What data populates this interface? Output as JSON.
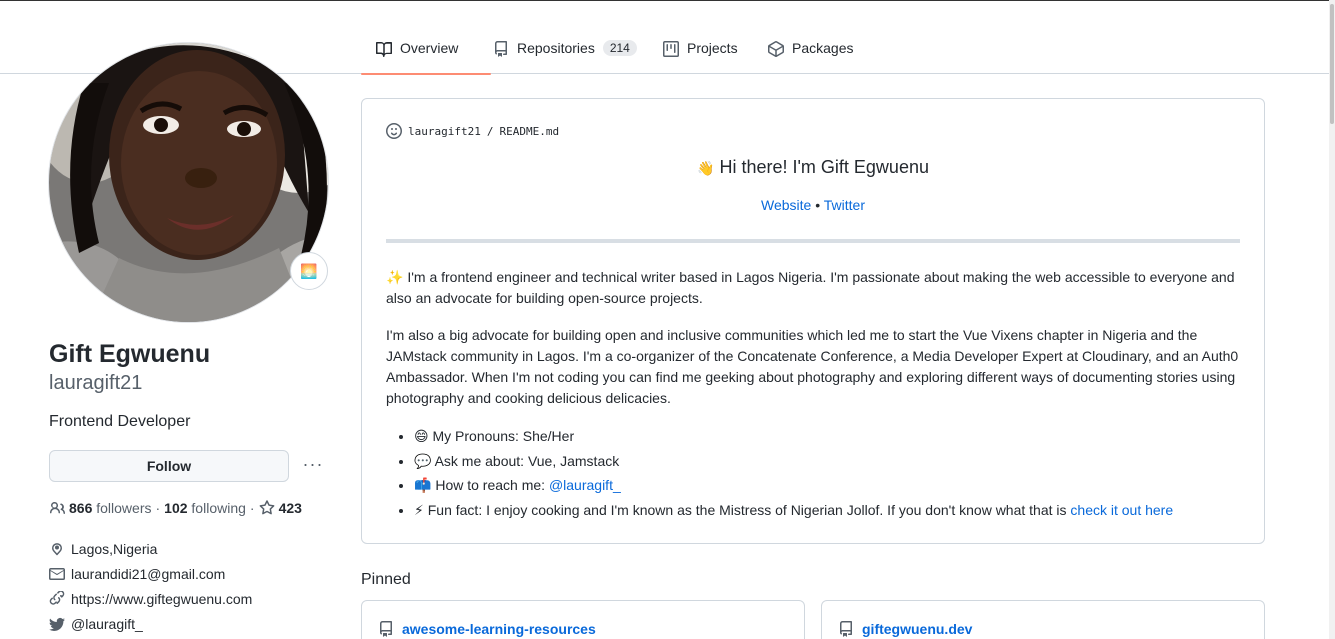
{
  "tabs": [
    {
      "label": "Overview",
      "icon": "book-icon"
    },
    {
      "label": "Repositories",
      "icon": "repo-icon",
      "count": "214"
    },
    {
      "label": "Projects",
      "icon": "project-icon"
    },
    {
      "label": "Packages",
      "icon": "package-icon"
    }
  ],
  "profile": {
    "name": "Gift Egwuenu",
    "login": "lauragift21",
    "bio": "Frontend Developer",
    "follow_label": "Follow",
    "more_label": "···",
    "status_emoji": "🌅",
    "followers_count": "866",
    "followers_label": "followers",
    "following_count": "102",
    "following_label": "following",
    "stars_count": "423",
    "location": "Lagos,Nigeria",
    "email": "laurandidi21@gmail.com",
    "website": "https://www.giftegwuenu.com",
    "twitter": "@lauragift_"
  },
  "readme": {
    "owner": "lauragift21",
    "separator": "/",
    "file": "README.md",
    "title_emoji": "👋",
    "title": "Hi there! I'm Gift Egwuenu",
    "link_website": "Website",
    "link_sep": "•",
    "link_twitter": "Twitter",
    "para1_emoji": "✨",
    "para1": "I'm a frontend engineer and technical writer based in Lagos Nigeria. I'm passionate about making the web accessible to everyone and also an advocate for building open-source projects.",
    "para2": "I'm also a big advocate for building open and inclusive communities which led me to start the Vue Vixens chapter in Nigeria and the JAMstack community in Lagos. I'm a co-organizer of the Concatenate Conference, a Media Developer Expert at Cloudinary, and an Auth0 Ambassador. When I'm not coding you can find me geeking about photography and exploring different ways of documenting stories using photography and cooking delicious delicacies.",
    "bullets": [
      {
        "emoji": "😄",
        "text": "My Pronouns: She/Her"
      },
      {
        "emoji": "💬",
        "text": "Ask me about: Vue, Jamstack"
      },
      {
        "emoji": "📫",
        "text": "How to reach me: ",
        "link": "@lauragift_"
      },
      {
        "emoji": "⚡",
        "text": "Fun fact: I enjoy cooking and I'm known as the Mistress of Nigerian Jollof. If you don't know what that is ",
        "link": "check it out here"
      }
    ]
  },
  "pinned": {
    "title": "Pinned",
    "repos": [
      "awesome-learning-resources",
      "giftegwuenu.dev"
    ]
  },
  "colors": {
    "accent_underline": "#fd8c73",
    "link": "#0969da",
    "text": "#24292f",
    "muted": "#57606a",
    "border": "#d0d7de"
  }
}
